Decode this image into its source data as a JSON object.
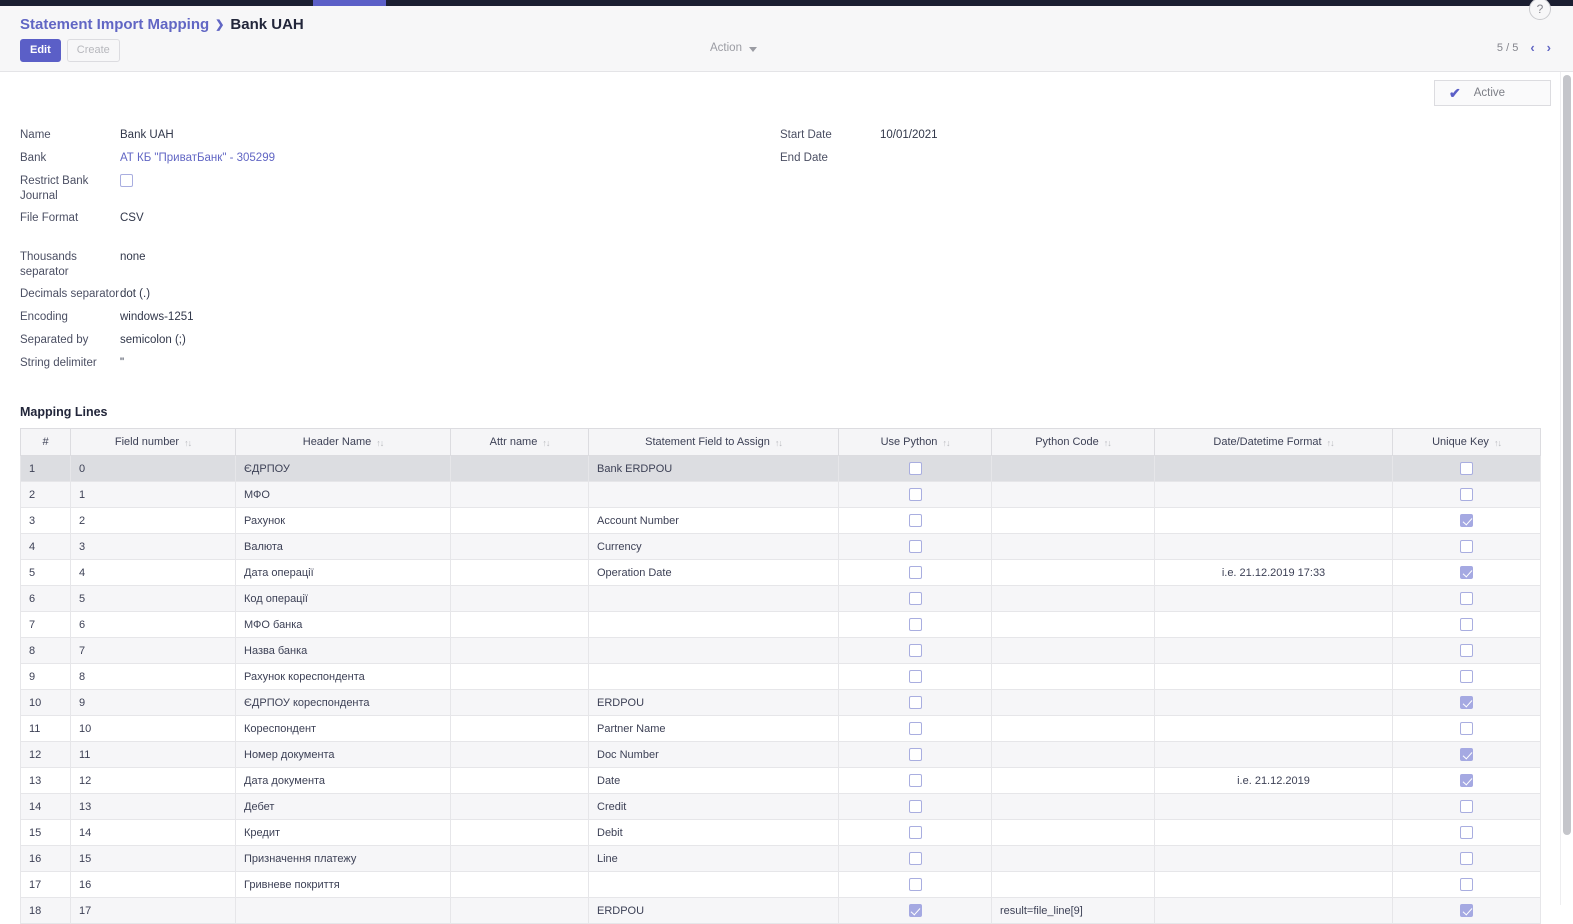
{
  "window": {
    "topbar_accent_color": "#5b5fc7",
    "topbar_color": "#1b1f32"
  },
  "header": {
    "breadcrumb_root": "Statement Import Mapping",
    "breadcrumb_sep": "❯",
    "breadcrumb_current": "Bank UAH",
    "edit_label": "Edit",
    "create_label": "Create",
    "action_label": "Action",
    "pager_text": "5 / 5",
    "pager_prev": "‹",
    "pager_next": "›",
    "help_label": "?"
  },
  "status": {
    "badge_label": "Active",
    "badge_check": "✔"
  },
  "form": {
    "left": [
      {
        "label": "Name",
        "value": "Bank UAH",
        "type": "text"
      },
      {
        "label": "Bank",
        "value": "АТ КБ \"ПриватБанк\" - 305299",
        "type": "link"
      },
      {
        "label": "Restrict Bank Journal",
        "value": false,
        "type": "checkbox"
      },
      {
        "label": "File Format",
        "value": "CSV",
        "type": "text"
      },
      {
        "label": "",
        "value": "",
        "type": "spacer"
      },
      {
        "label": "Thousands separator",
        "value": "none",
        "type": "text"
      },
      {
        "label": "Decimals separator",
        "value": "dot (.)",
        "type": "text"
      },
      {
        "label": "Encoding",
        "value": "windows-1251",
        "type": "text"
      },
      {
        "label": "Separated by",
        "value": "semicolon (;)",
        "type": "text"
      },
      {
        "label": "String delimiter",
        "value": "\"",
        "type": "text"
      }
    ],
    "right": [
      {
        "label": "Start Date",
        "value": "10/01/2021",
        "type": "text"
      },
      {
        "label": "End Date",
        "value": "",
        "type": "text"
      }
    ]
  },
  "mapping_lines": {
    "title": "Mapping Lines",
    "sort_icon": "↑↓",
    "columns": [
      "#",
      "Field number",
      "Header Name",
      "Attr name",
      "Statement Field to Assign",
      "Use Python",
      "Python Code",
      "Date/Datetime Format",
      "Unique Key"
    ],
    "rows": [
      {
        "idx": "1",
        "field_number": "0",
        "header_name": "ЄДРПОУ",
        "attr_name": "",
        "statement_field": "Bank ERDPOU",
        "use_python": false,
        "python_code": "",
        "date_format": "",
        "unique_key": false,
        "selected": true
      },
      {
        "idx": "2",
        "field_number": "1",
        "header_name": "МФО",
        "attr_name": "",
        "statement_field": "",
        "use_python": false,
        "python_code": "",
        "date_format": "",
        "unique_key": false,
        "selected": false
      },
      {
        "idx": "3",
        "field_number": "2",
        "header_name": "Рахунок",
        "attr_name": "",
        "statement_field": "Account Number",
        "use_python": false,
        "python_code": "",
        "date_format": "",
        "unique_key": true,
        "selected": false
      },
      {
        "idx": "4",
        "field_number": "3",
        "header_name": "Валюта",
        "attr_name": "",
        "statement_field": "Currency",
        "use_python": false,
        "python_code": "",
        "date_format": "",
        "unique_key": false,
        "selected": false
      },
      {
        "idx": "5",
        "field_number": "4",
        "header_name": "Дата операції",
        "attr_name": "",
        "statement_field": "Operation Date",
        "use_python": false,
        "python_code": "",
        "date_format": "i.e. 21.12.2019 17:33",
        "unique_key": true,
        "selected": false
      },
      {
        "idx": "6",
        "field_number": "5",
        "header_name": "Код операції",
        "attr_name": "",
        "statement_field": "",
        "use_python": false,
        "python_code": "",
        "date_format": "",
        "unique_key": false,
        "selected": false
      },
      {
        "idx": "7",
        "field_number": "6",
        "header_name": "МФО банка",
        "attr_name": "",
        "statement_field": "",
        "use_python": false,
        "python_code": "",
        "date_format": "",
        "unique_key": false,
        "selected": false
      },
      {
        "idx": "8",
        "field_number": "7",
        "header_name": "Назва банка",
        "attr_name": "",
        "statement_field": "",
        "use_python": false,
        "python_code": "",
        "date_format": "",
        "unique_key": false,
        "selected": false
      },
      {
        "idx": "9",
        "field_number": "8",
        "header_name": "Рахунок кореспондента",
        "attr_name": "",
        "statement_field": "",
        "use_python": false,
        "python_code": "",
        "date_format": "",
        "unique_key": false,
        "selected": false
      },
      {
        "idx": "10",
        "field_number": "9",
        "header_name": "ЄДРПОУ кореспондента",
        "attr_name": "",
        "statement_field": "ERDPOU",
        "use_python": false,
        "python_code": "",
        "date_format": "",
        "unique_key": true,
        "selected": false
      },
      {
        "idx": "11",
        "field_number": "10",
        "header_name": "Кореспондент",
        "attr_name": "",
        "statement_field": "Partner Name",
        "use_python": false,
        "python_code": "",
        "date_format": "",
        "unique_key": false,
        "selected": false
      },
      {
        "idx": "12",
        "field_number": "11",
        "header_name": "Номер документа",
        "attr_name": "",
        "statement_field": "Doc Number",
        "use_python": false,
        "python_code": "",
        "date_format": "",
        "unique_key": true,
        "selected": false
      },
      {
        "idx": "13",
        "field_number": "12",
        "header_name": "Дата документа",
        "attr_name": "",
        "statement_field": "Date",
        "use_python": false,
        "python_code": "",
        "date_format": "i.e. 21.12.2019",
        "unique_key": true,
        "selected": false
      },
      {
        "idx": "14",
        "field_number": "13",
        "header_name": "Дебет",
        "attr_name": "",
        "statement_field": "Credit",
        "use_python": false,
        "python_code": "",
        "date_format": "",
        "unique_key": false,
        "selected": false
      },
      {
        "idx": "15",
        "field_number": "14",
        "header_name": "Кредит",
        "attr_name": "",
        "statement_field": "Debit",
        "use_python": false,
        "python_code": "",
        "date_format": "",
        "unique_key": false,
        "selected": false
      },
      {
        "idx": "16",
        "field_number": "15",
        "header_name": "Призначення платежу",
        "attr_name": "",
        "statement_field": "Line",
        "use_python": false,
        "python_code": "",
        "date_format": "",
        "unique_key": false,
        "selected": false
      },
      {
        "idx": "17",
        "field_number": "16",
        "header_name": "Гривневе покриття",
        "attr_name": "",
        "statement_field": "",
        "use_python": false,
        "python_code": "",
        "date_format": "",
        "unique_key": false,
        "selected": false
      },
      {
        "idx": "18",
        "field_number": "17",
        "header_name": "",
        "attr_name": "",
        "statement_field": "ERDPOU",
        "use_python": true,
        "python_code": "result=file_line[9]",
        "date_format": "",
        "unique_key": true,
        "selected": false
      }
    ]
  }
}
